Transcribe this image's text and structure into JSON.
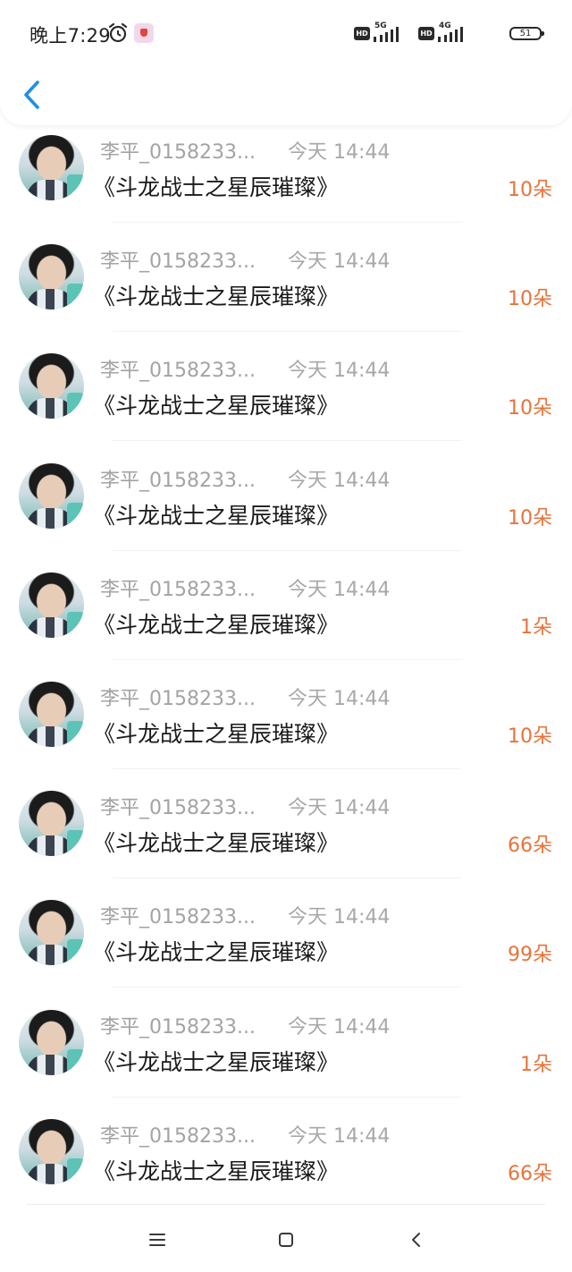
{
  "status_bar": {
    "time": "晚上7:29",
    "icons": [
      "alarm-icon",
      "app-notification-icon"
    ],
    "hd_label": "HD",
    "network_1": "5G",
    "network_2": "4G",
    "battery": "51"
  },
  "nav": {
    "back_icon": "chevron-left-icon"
  },
  "colors": {
    "accent": "#1e90e8",
    "count": "#e8733a",
    "secondary_text": "#a3a3a3"
  },
  "gifts": [
    {
      "sender": "李平_0158233...",
      "time": "今天 14:44",
      "title": "《斗龙战士之星辰璀璨》",
      "count": "10朵"
    },
    {
      "sender": "李平_0158233...",
      "time": "今天 14:44",
      "title": "《斗龙战士之星辰璀璨》",
      "count": "10朵"
    },
    {
      "sender": "李平_0158233...",
      "time": "今天 14:44",
      "title": "《斗龙战士之星辰璀璨》",
      "count": "10朵"
    },
    {
      "sender": "李平_0158233...",
      "time": "今天 14:44",
      "title": "《斗龙战士之星辰璀璨》",
      "count": "10朵"
    },
    {
      "sender": "李平_0158233...",
      "time": "今天 14:44",
      "title": "《斗龙战士之星辰璀璨》",
      "count": "1朵"
    },
    {
      "sender": "李平_0158233...",
      "time": "今天 14:44",
      "title": "《斗龙战士之星辰璀璨》",
      "count": "10朵"
    },
    {
      "sender": "李平_0158233...",
      "time": "今天 14:44",
      "title": "《斗龙战士之星辰璀璨》",
      "count": "66朵"
    },
    {
      "sender": "李平_0158233...",
      "time": "今天 14:44",
      "title": "《斗龙战士之星辰璀璨》",
      "count": "99朵"
    },
    {
      "sender": "李平_0158233...",
      "time": "今天 14:44",
      "title": "《斗龙战士之星辰璀璨》",
      "count": "1朵"
    },
    {
      "sender": "李平_0158233...",
      "time": "今天 14:44",
      "title": "《斗龙战士之星辰璀璨》",
      "count": "66朵"
    }
  ],
  "system_nav": {
    "icons": [
      "menu-icon",
      "home-icon",
      "back-icon"
    ]
  }
}
